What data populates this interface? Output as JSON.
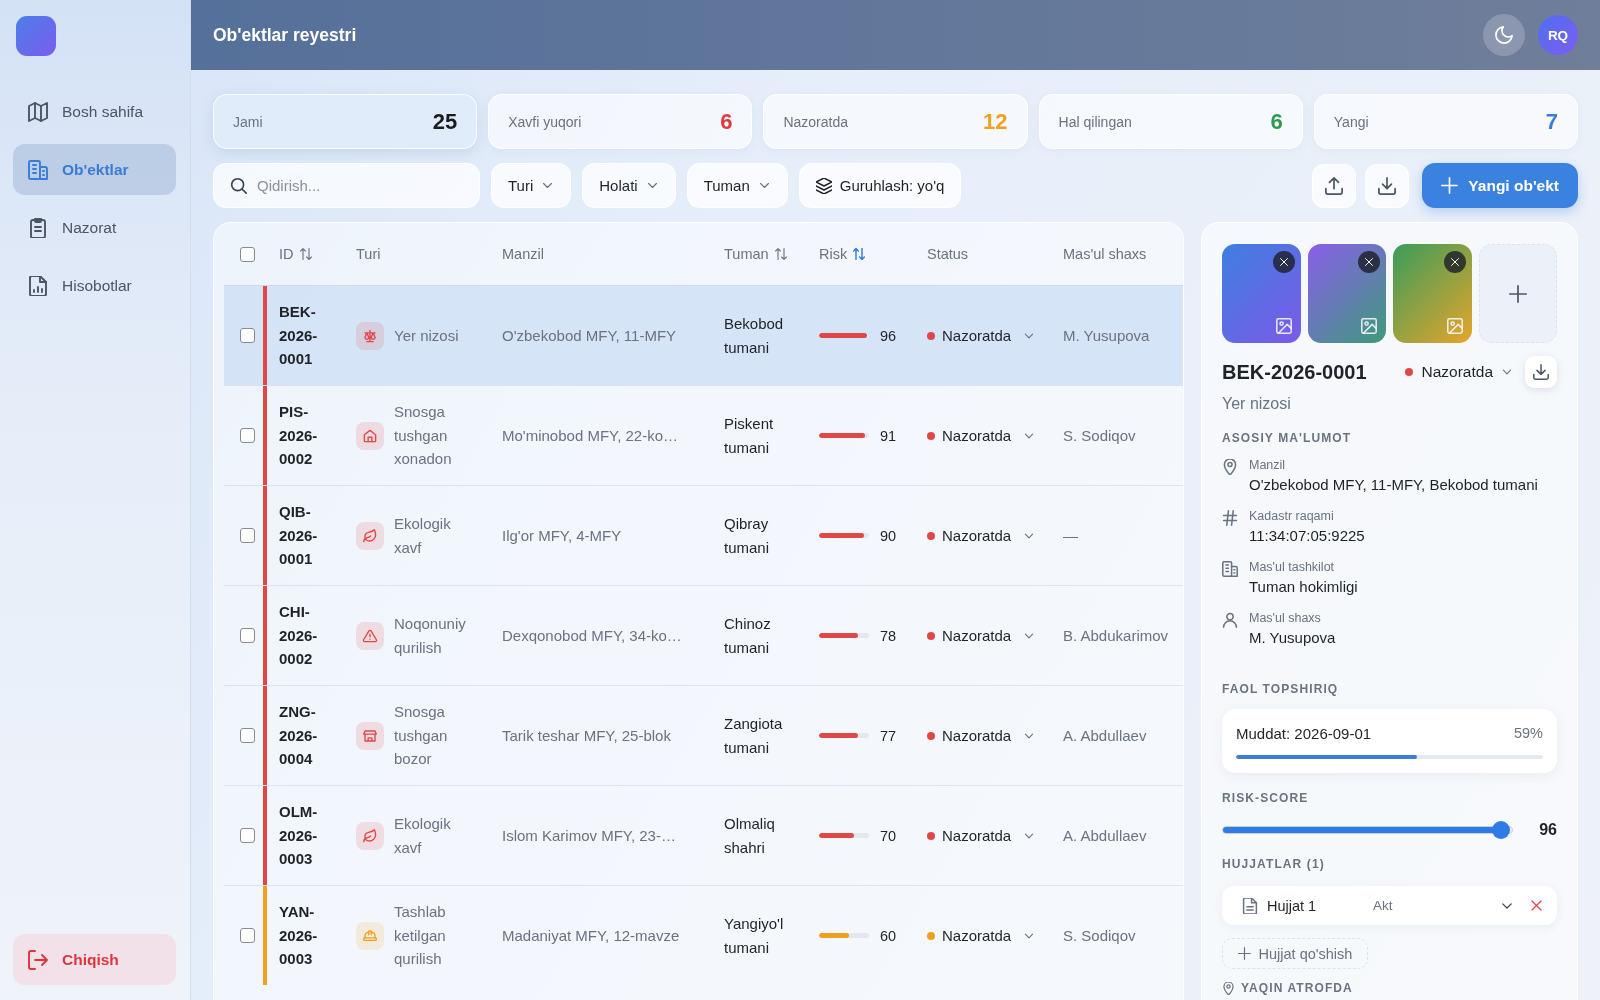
{
  "sidebar": {
    "items": [
      {
        "label": "Bosh sahifa",
        "kind": "home",
        "selected": false
      },
      {
        "label": "Ob'ektlar",
        "kind": "objects",
        "selected": true
      },
      {
        "label": "Nazorat",
        "kind": "control",
        "selected": false
      },
      {
        "label": "Hisobotlar",
        "kind": "reports",
        "selected": false
      }
    ],
    "logout": "Chiqish"
  },
  "header": {
    "title": "Ob'ektlar reyestri",
    "avatar": "RQ"
  },
  "stats": [
    {
      "label": "Jami",
      "value": "25",
      "color": "#1c1c1e",
      "selected": true
    },
    {
      "label": "Xavfi yuqori",
      "value": "6",
      "color": "#e0393e",
      "selected": false
    },
    {
      "label": "Nazoratda",
      "value": "12",
      "color": "#f0a020",
      "selected": false
    },
    {
      "label": "Hal qilingan",
      "value": "6",
      "color": "#2f9a4f",
      "selected": false
    },
    {
      "label": "Yangi",
      "value": "7",
      "color": "#3b7dd8",
      "selected": false
    }
  ],
  "toolbar": {
    "search": {
      "placeholder": "Qidirish..."
    },
    "filters": [
      {
        "label": "Turi",
        "kind": "dropdown"
      },
      {
        "label": "Holati",
        "kind": "dropdown"
      },
      {
        "label": "Tuman",
        "kind": "dropdown"
      },
      {
        "label": "Guruhlash: yo'q",
        "kind": "group"
      }
    ],
    "new_button": "Yangi ob'ekt"
  },
  "table": {
    "select_all": {
      "checked": false
    },
    "columns": [
      {
        "label": "ID",
        "sortable": true,
        "sorted": false
      },
      {
        "label": "Turi",
        "sortable": false,
        "sorted": false
      },
      {
        "label": "Manzil",
        "sortable": false,
        "sorted": false
      },
      {
        "label": "Tuman",
        "sortable": true,
        "sorted": false
      },
      {
        "label": "Risk",
        "sortable": true,
        "sorted": true
      },
      {
        "label": "Status",
        "sortable": false,
        "sorted": false
      },
      {
        "label": "Mas'ul shaxs",
        "sortable": false,
        "sorted": false
      }
    ],
    "rows": [
      {
        "id": "BEK-2026-0001",
        "kind": "dispute",
        "category": "Yer nizosi",
        "address": "O'zbekobod MFY, 11-MFY",
        "district": "Bekobod tumani",
        "level": 0.96,
        "risk": "96",
        "status": "Nazoratda",
        "person": "M. Yusupova",
        "color": "#e04848",
        "checked": false,
        "selected": true
      },
      {
        "id": "PIS-2026-0002",
        "kind": "demolition",
        "category": "Snosga tushgan xonadon",
        "address": "Mo'minobod MFY, 22-ko…",
        "district": "Piskent tumani",
        "level": 0.91,
        "risk": "91",
        "status": "Nazoratda",
        "person": "S. Sodiqov",
        "color": "#e04848",
        "checked": false,
        "selected": false
      },
      {
        "id": "QIB-2026-0001",
        "kind": "ecology",
        "category": "Ekologik xavf",
        "address": "Ilg'or MFY, 4-MFY",
        "district": "Qibray tumani",
        "level": 0.9,
        "risk": "90",
        "status": "Nazoratda",
        "person": "—",
        "color": "#e04848",
        "checked": false,
        "selected": false
      },
      {
        "id": "CHI-2026-0002",
        "kind": "illegal",
        "category": "Noqonuniy qurilish",
        "address": "Dexqonobod MFY, 34-ko…",
        "district": "Chinoz tumani",
        "level": 0.78,
        "risk": "78",
        "status": "Nazoratda",
        "person": "B. Abdukarimov",
        "color": "#e04848",
        "checked": false,
        "selected": false
      },
      {
        "id": "ZNG-2026-0004",
        "kind": "market",
        "category": "Snosga tushgan bozor",
        "address": "Tarik teshar MFY, 25-blok",
        "district": "Zangiota tumani",
        "level": 0.77,
        "risk": "77",
        "status": "Nazoratda",
        "person": "A. Abdullaev",
        "color": "#e04848",
        "checked": false,
        "selected": false
      },
      {
        "id": "OLM-2026-0003",
        "kind": "ecology",
        "category": "Ekologik xavf",
        "address": "Islom Karimov MFY, 23-…",
        "district": "Olmaliq shahri",
        "level": 0.7,
        "risk": "70",
        "status": "Nazoratda",
        "person": "A. Abdullaev",
        "color": "#e04848",
        "checked": false,
        "selected": false
      },
      {
        "id": "YAN-2026-0003",
        "kind": "abandoned",
        "category": "Tashlab ketilgan qurilish",
        "address": "Madaniyat MFY, 12-mavze",
        "district": "Yangiyo'l tumani",
        "level": 0.6,
        "risk": "60",
        "status": "Nazoratda",
        "person": "S. Sodiqov",
        "color": "#f0a020",
        "checked": false,
        "selected": false
      }
    ]
  },
  "details": {
    "photos": [
      {
        "kind": "ocean"
      },
      {
        "kind": "dusk"
      },
      {
        "kind": "meadow"
      }
    ],
    "id": "BEK-2026-0001",
    "status": {
      "label": "Nazoratda",
      "color": "#e04848"
    },
    "category": "Yer nizosi",
    "info_title": "ASOSIY MA'LUMOT",
    "info": [
      {
        "kind": "location",
        "label": "Manzil",
        "value": "O'zbekobod MFY, 11-MFY, Bekobod tumani"
      },
      {
        "kind": "cadastre",
        "label": "Kadastr raqami",
        "value": "11:34:07:05:9225"
      },
      {
        "kind": "organization",
        "label": "Mas'ul tashkilot",
        "value": "Tuman hokimligi"
      },
      {
        "kind": "person",
        "label": "Mas'ul shaxs",
        "value": "M. Yusupova"
      }
    ],
    "task_title": "FAOL TOPSHIRIQ",
    "task": {
      "deadline": "Muddat: 2026-09-01",
      "percent": "59%",
      "level": 0.59
    },
    "risk_title": "RISK-SCORE",
    "risk": {
      "level": 0.96,
      "value": "96"
    },
    "documents_title": "HUJJATLAR (1)",
    "documents": [
      {
        "name": "Hujjat 1",
        "doc_type": "Akt"
      }
    ],
    "add_document": "Hujjat qo'shish",
    "nearby_title": "YAQIN ATROFDA"
  }
}
